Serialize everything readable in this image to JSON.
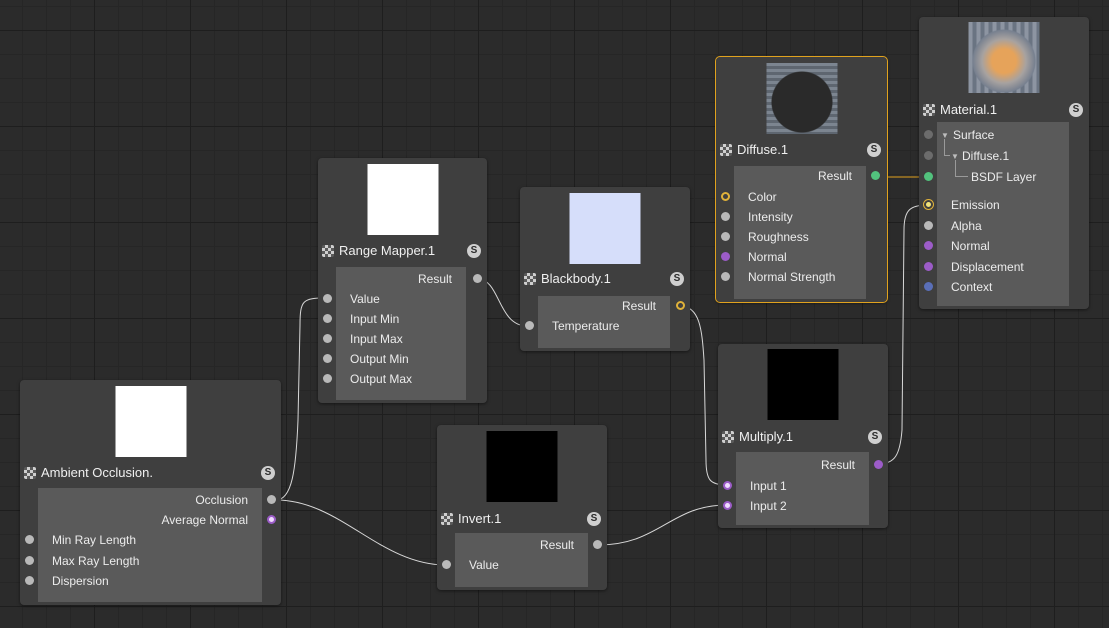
{
  "nodes": {
    "range_mapper": {
      "title": "Range Mapper.1",
      "badge": "S",
      "preview_color": "#ffffff",
      "output": "Result",
      "inputs": [
        "Value",
        "Input Min",
        "Input Max",
        "Output Min",
        "Output Max"
      ]
    },
    "blackbody": {
      "title": "Blackbody.1",
      "badge": "S",
      "preview_color": "#d6defa",
      "output": "Result",
      "inputs": [
        "Temperature"
      ]
    },
    "diffuse": {
      "title": "Diffuse.1",
      "badge": "S",
      "output": "Result",
      "inputs": [
        "Color",
        "Intensity",
        "Roughness",
        "Normal",
        "Normal Strength"
      ]
    },
    "material": {
      "title": "Material.1",
      "badge": "S",
      "tree": [
        "Surface",
        "Diffuse.1",
        "BSDF Layer"
      ],
      "inputs": [
        "Emission",
        "Alpha",
        "Normal",
        "Displacement",
        "Context"
      ]
    },
    "ambient_occlusion": {
      "title": "Ambient Occlusion.",
      "badge": "S",
      "preview_color": "#ffffff",
      "outputs": [
        "Occlusion",
        "Average Normal"
      ],
      "inputs": [
        "Min Ray Length",
        "Max Ray Length",
        "Dispersion"
      ]
    },
    "invert": {
      "title": "Invert.1",
      "badge": "S",
      "preview_color": "#000000",
      "output": "Result",
      "inputs": [
        "Value"
      ]
    },
    "multiply": {
      "title": "Multiply.1",
      "badge": "S",
      "preview_color": "#000000",
      "output": "Result",
      "inputs": [
        "Input 1",
        "Input 2"
      ]
    }
  },
  "colors": {
    "selected_outline": "#e0a21e",
    "wire": "#d8d8d8",
    "wire_selected": "#e0a21e"
  }
}
